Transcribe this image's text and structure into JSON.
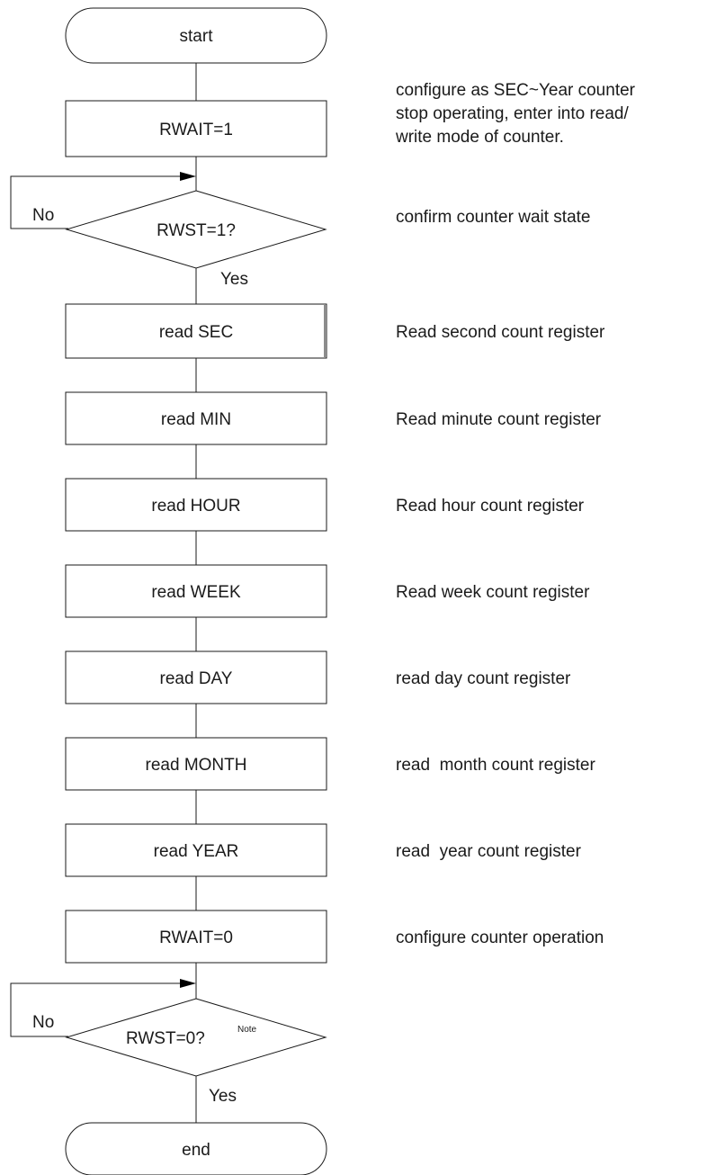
{
  "flowchart": {
    "start": "start",
    "end": "end",
    "steps": {
      "rwait_set": "RWAIT=1",
      "check_rwst1": "RWST=1?",
      "read_sec": "read SEC",
      "read_min": "read MIN",
      "read_hour": "read HOUR",
      "read_week": "read WEEK",
      "read_day": "read DAY",
      "read_month": "read MONTH",
      "read_year": "read YEAR",
      "rwait_clear": "RWAIT=0",
      "check_rwst0": "RWST=0?",
      "check_rwst0_note": "Note"
    },
    "branch": {
      "no": "No",
      "yes": "Yes"
    }
  },
  "descriptions": {
    "rwait_set": [
      "configure as SEC~Year counter",
      "stop operating, enter into read/",
      "write mode of counter."
    ],
    "check_rwst1": "confirm counter wait state",
    "read_sec": "Read second count register",
    "read_min": "Read minute count register",
    "read_hour": "Read hour count register",
    "read_week": "Read week count register",
    "read_day": "read day count register",
    "read_month": "read  month count register",
    "read_year": "read  year count register",
    "rwait_clear": "configure counter operation"
  }
}
